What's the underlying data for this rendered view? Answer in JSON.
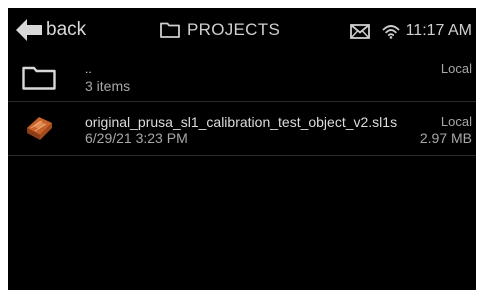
{
  "header": {
    "back_label": "back",
    "title": "PROJECTS",
    "time": "11:17 AM"
  },
  "icons": {
    "back": "arrow-left-icon",
    "title": "folder-icon",
    "mail": "mail-icon",
    "wifi": "wifi-icon",
    "up_folder": "folder-icon",
    "file": "sl1s-file-thumbnail"
  },
  "colors": {
    "background": "#000000",
    "text": "#dcdcdc",
    "secondary_text": "#a8a8a8",
    "file_thumbnail": "#c8622a"
  },
  "items": [
    {
      "name": "..",
      "detail": "3 items",
      "location": "Local",
      "size": ""
    },
    {
      "name": "original_prusa_sl1_calibration_test_object_v2.sl1s",
      "detail": "6/29/21 3:23 PM",
      "location": "Local",
      "size": "2.97 MB"
    }
  ]
}
